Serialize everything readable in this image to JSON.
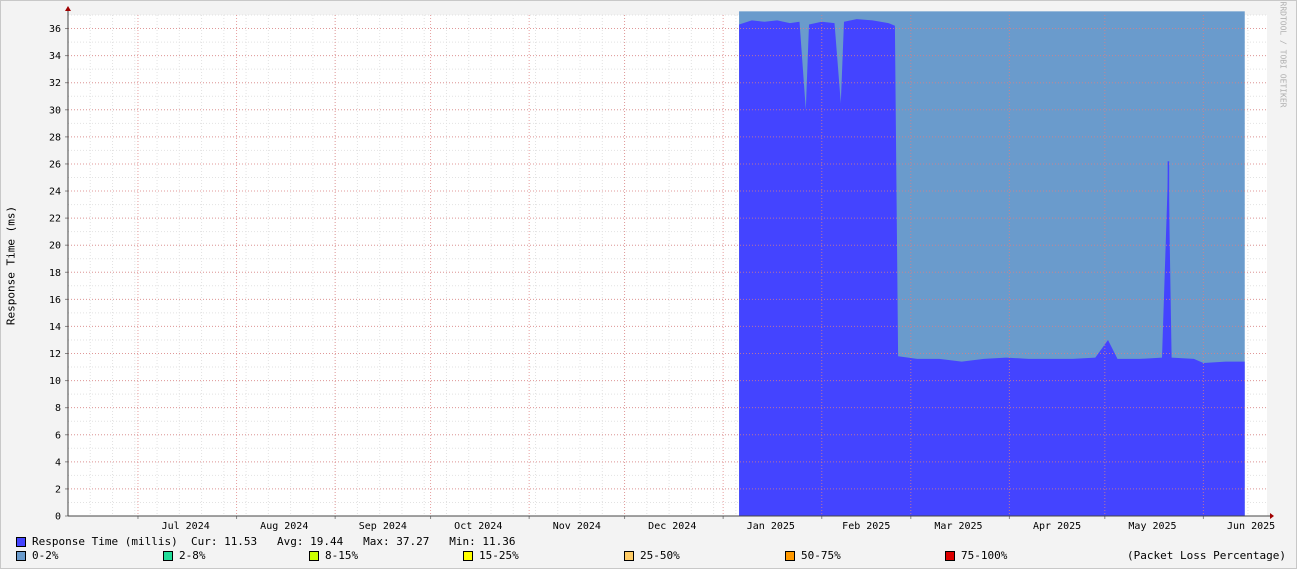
{
  "chart_data": {
    "type": "area",
    "title": "",
    "xlabel": "",
    "ylabel": "Response Time (ms)",
    "ylim": [
      0,
      37
    ],
    "yticks": [
      0,
      2,
      4,
      6,
      8,
      10,
      12,
      14,
      16,
      18,
      20,
      22,
      24,
      26,
      28,
      30,
      32,
      34,
      36
    ],
    "xlim": [
      "2024-06-09",
      "2025-06-21"
    ],
    "xticks": [
      {
        "date": "2024-07-01",
        "label": "Jul 2024"
      },
      {
        "date": "2024-08-01",
        "label": "Aug 2024"
      },
      {
        "date": "2024-09-01",
        "label": "Sep 2024"
      },
      {
        "date": "2024-10-01",
        "label": "Oct 2024"
      },
      {
        "date": "2024-11-01",
        "label": "Nov 2024"
      },
      {
        "date": "2024-12-01",
        "label": "Dec 2024"
      },
      {
        "date": "2025-01-01",
        "label": "Jan 2025"
      },
      {
        "date": "2025-02-01",
        "label": "Feb 2025"
      },
      {
        "date": "2025-03-01",
        "label": "Mar 2025"
      },
      {
        "date": "2025-04-01",
        "label": "Apr 2025"
      },
      {
        "date": "2025-05-01",
        "label": "May 2025"
      },
      {
        "date": "2025-06-01",
        "label": "Jun 2025"
      }
    ],
    "grid": true,
    "series": [
      {
        "name": "Response Time (millis)",
        "color": "#4444ff",
        "points": [
          [
            "2025-01-06",
            36.3
          ],
          [
            "2025-01-10",
            36.6
          ],
          [
            "2025-01-14",
            36.5
          ],
          [
            "2025-01-18",
            36.6
          ],
          [
            "2025-01-22",
            36.4
          ],
          [
            "2025-01-25",
            36.5
          ],
          [
            "2025-01-27",
            30.0
          ],
          [
            "2025-01-28",
            36.3
          ],
          [
            "2025-02-01",
            36.5
          ],
          [
            "2025-02-05",
            36.4
          ],
          [
            "2025-02-07",
            30.5
          ],
          [
            "2025-02-08",
            36.5
          ],
          [
            "2025-02-12",
            36.7
          ],
          [
            "2025-02-17",
            36.6
          ],
          [
            "2025-02-22",
            36.4
          ],
          [
            "2025-02-24",
            36.2
          ],
          [
            "2025-02-25",
            11.8
          ],
          [
            "2025-03-03",
            11.6
          ],
          [
            "2025-03-10",
            11.6
          ],
          [
            "2025-03-17",
            11.4
          ],
          [
            "2025-03-24",
            11.6
          ],
          [
            "2025-03-31",
            11.7
          ],
          [
            "2025-04-07",
            11.6
          ],
          [
            "2025-04-14",
            11.6
          ],
          [
            "2025-04-21",
            11.6
          ],
          [
            "2025-04-28",
            11.7
          ],
          [
            "2025-05-02",
            13.0
          ],
          [
            "2025-05-05",
            11.6
          ],
          [
            "2025-05-12",
            11.6
          ],
          [
            "2025-05-19",
            11.7
          ],
          [
            "2025-05-21",
            26.2
          ],
          [
            "2025-05-22",
            11.7
          ],
          [
            "2025-05-29",
            11.6
          ],
          [
            "2025-06-01",
            11.3
          ],
          [
            "2025-06-08",
            11.4
          ],
          [
            "2025-06-14",
            11.4
          ]
        ]
      },
      {
        "name": "0-2%",
        "color": "#6a9bcc",
        "points": [
          [
            "2025-01-06",
            37.27
          ],
          [
            "2025-06-14",
            37.27
          ]
        ]
      }
    ],
    "annotations": {
      "spike_dates": [
        "2025-01-27",
        "2025-02-07",
        "2025-05-21"
      ]
    }
  },
  "legend": {
    "rt_label": "Response Time (millis)",
    "rt_color": "#4444ff",
    "stats": "Cur: 11.53   Avg: 19.44   Max: 37.27   Min: 11.36",
    "items": [
      {
        "label": "0-2%",
        "color": "#6a9bcc"
      },
      {
        "label": "2-8%",
        "color": "#22dd99"
      },
      {
        "label": "8-15%",
        "color": "#ccff00"
      },
      {
        "label": "15-25%",
        "color": "#ffff00"
      },
      {
        "label": "25-50%",
        "color": "#ffcc66"
      },
      {
        "label": "50-75%",
        "color": "#ff9900"
      },
      {
        "label": "75-100%",
        "color": "#dd0000"
      }
    ],
    "packet_loss_label": "(Packet Loss Percentage)"
  },
  "watermark": "RRDTOOL / TOBI OETIKER"
}
